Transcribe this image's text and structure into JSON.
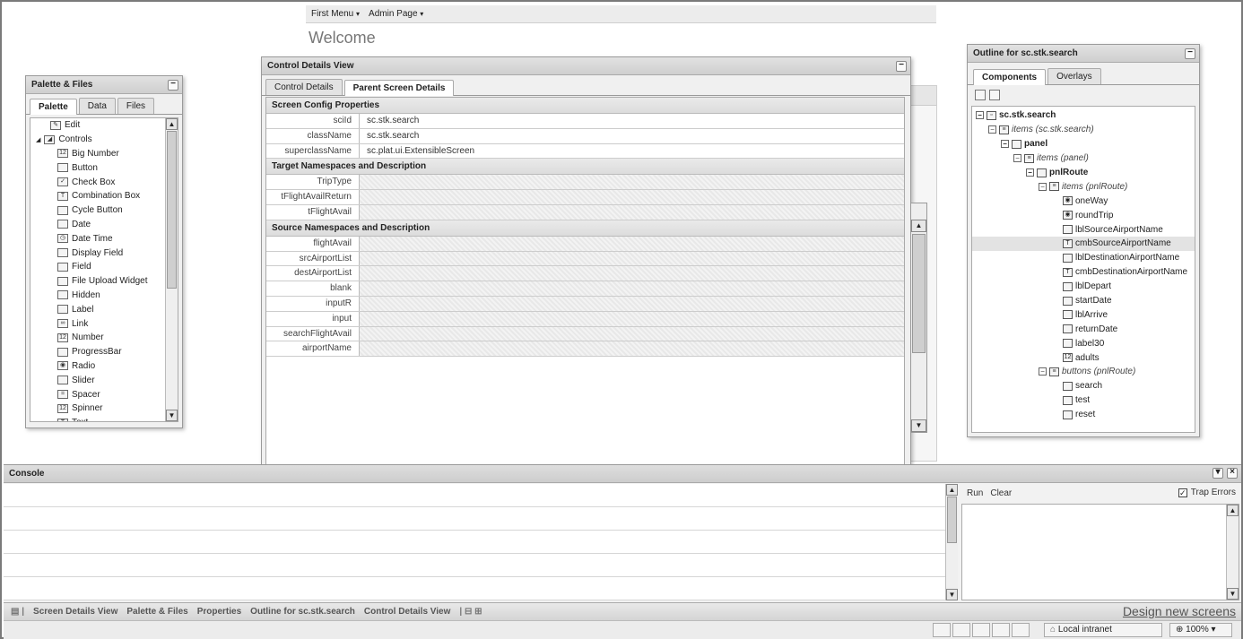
{
  "top_menu": {
    "items": [
      {
        "label": "First Menu"
      },
      {
        "label": "Admin Page"
      }
    ],
    "caret": "▾",
    "welcome": "Welcome"
  },
  "palette": {
    "title": "Palette & Files",
    "tabs": [
      "Palette",
      "Data",
      "Files"
    ],
    "items": [
      {
        "label": "Edit",
        "icon": "pencil-icon",
        "glyph": "✎",
        "level": 0
      },
      {
        "label": "Controls",
        "icon": "folder-icon",
        "glyph": "◢",
        "level": 0
      },
      {
        "label": "Big Number",
        "icon": "number-icon",
        "glyph": "12",
        "level": 2
      },
      {
        "label": "Button",
        "icon": "button-icon",
        "glyph": "",
        "level": 2
      },
      {
        "label": "Check Box",
        "icon": "checkbox-icon",
        "glyph": "✓",
        "level": 2
      },
      {
        "label": "Combination Box",
        "icon": "combobox-icon",
        "glyph": "T",
        "level": 2
      },
      {
        "label": "Cycle Button",
        "icon": "cycle-button-icon",
        "glyph": "",
        "level": 2
      },
      {
        "label": "Date",
        "icon": "calendar-icon",
        "glyph": "",
        "level": 2
      },
      {
        "label": "Date Time",
        "icon": "clock-icon",
        "glyph": "◷",
        "level": 2
      },
      {
        "label": "Display Field",
        "icon": "display-field-icon",
        "glyph": "",
        "level": 2
      },
      {
        "label": "Field",
        "icon": "field-icon",
        "glyph": "",
        "level": 2
      },
      {
        "label": "File Upload Widget",
        "icon": "file-upload-icon",
        "glyph": "",
        "level": 2
      },
      {
        "label": "Hidden",
        "icon": "hidden-icon",
        "glyph": "",
        "level": 2
      },
      {
        "label": "Label",
        "icon": "label-icon",
        "glyph": "",
        "level": 2
      },
      {
        "label": "Link",
        "icon": "link-icon",
        "glyph": "∞",
        "level": 2
      },
      {
        "label": "Number",
        "icon": "number-icon",
        "glyph": "12",
        "level": 2
      },
      {
        "label": "ProgressBar",
        "icon": "progressbar-icon",
        "glyph": "",
        "level": 2
      },
      {
        "label": "Radio",
        "icon": "radio-icon",
        "glyph": "◉",
        "level": 2
      },
      {
        "label": "Slider",
        "icon": "slider-icon",
        "glyph": "",
        "level": 2
      },
      {
        "label": "Spacer",
        "icon": "spacer-icon",
        "glyph": "=",
        "level": 2
      },
      {
        "label": "Spinner",
        "icon": "spinner-icon",
        "glyph": "12",
        "level": 2
      },
      {
        "label": "Text",
        "icon": "text-icon",
        "glyph": "T",
        "level": 2
      }
    ]
  },
  "control_details": {
    "title": "Control Details View",
    "tabs": [
      "Control Details",
      "Parent Screen Details"
    ],
    "sections": [
      {
        "title": "Screen Config Properties",
        "rows": [
          {
            "key": "sciId",
            "value": "sc.stk.search"
          },
          {
            "key": "className",
            "value": "sc.stk.search"
          },
          {
            "key": "superclassName",
            "value": "sc.plat.ui.ExtensibleScreen"
          }
        ]
      },
      {
        "title": "Target Namespaces and Description",
        "rows": [
          {
            "key": "TripType",
            "value": ""
          },
          {
            "key": "tFlightAvailReturn",
            "value": ""
          },
          {
            "key": "tFlightAvail",
            "value": ""
          }
        ]
      },
      {
        "title": "Source Namespaces and Description",
        "rows": [
          {
            "key": "flightAvail",
            "value": ""
          },
          {
            "key": "srcAirportList",
            "value": ""
          },
          {
            "key": "destAirportList",
            "value": ""
          },
          {
            "key": "blank",
            "value": ""
          },
          {
            "key": "inputR",
            "value": ""
          },
          {
            "key": "input",
            "value": ""
          },
          {
            "key": "searchFlightAvail",
            "value": ""
          },
          {
            "key": "airportName",
            "value": ""
          }
        ]
      }
    ]
  },
  "outline": {
    "title": "Outline for sc.stk.search",
    "tabs": [
      "Components",
      "Overlays"
    ],
    "tree": [
      {
        "label": "sc.stk.search",
        "depth": 0,
        "style": "bold",
        "expander": "⊟",
        "icon": "screen-icon",
        "glyph": "▫"
      },
      {
        "label": "items (sc.stk.search)",
        "depth": 1,
        "style": "it",
        "expander": "⊟",
        "icon": "list-icon",
        "glyph": "≡"
      },
      {
        "label": "panel",
        "depth": 2,
        "style": "bold",
        "expander": "⊟",
        "icon": "panel-icon",
        "glyph": ""
      },
      {
        "label": "items (panel)",
        "depth": 3,
        "style": "it",
        "expander": "⊟",
        "icon": "list-icon",
        "glyph": "≡"
      },
      {
        "label": "pnlRoute",
        "depth": 4,
        "style": "bold",
        "expander": "⊟",
        "icon": "panel-icon",
        "glyph": ""
      },
      {
        "label": "items (pnlRoute)",
        "depth": 5,
        "style": "it",
        "expander": "⊟",
        "icon": "list-icon",
        "glyph": "≡"
      },
      {
        "label": "oneWay",
        "depth": 6,
        "style": "",
        "expander": "",
        "icon": "radio-icon",
        "glyph": "◉"
      },
      {
        "label": "roundTrip",
        "depth": 6,
        "style": "",
        "expander": "",
        "icon": "radio-icon",
        "glyph": "◉"
      },
      {
        "label": "lblSourceAirportName",
        "depth": 6,
        "style": "",
        "expander": "",
        "icon": "label-icon",
        "glyph": ""
      },
      {
        "label": "cmbSourceAirportName",
        "depth": 6,
        "style": "sel",
        "expander": "",
        "icon": "combobox-icon",
        "glyph": "T"
      },
      {
        "label": "lblDestinationAirportName",
        "depth": 6,
        "style": "",
        "expander": "",
        "icon": "label-icon",
        "glyph": ""
      },
      {
        "label": "cmbDestinationAirportName",
        "depth": 6,
        "style": "",
        "expander": "",
        "icon": "combobox-icon",
        "glyph": "T"
      },
      {
        "label": "lblDepart",
        "depth": 6,
        "style": "",
        "expander": "",
        "icon": "label-icon",
        "glyph": ""
      },
      {
        "label": "startDate",
        "depth": 6,
        "style": "",
        "expander": "",
        "icon": "calendar-icon",
        "glyph": ""
      },
      {
        "label": "lblArrive",
        "depth": 6,
        "style": "",
        "expander": "",
        "icon": "label-icon",
        "glyph": ""
      },
      {
        "label": "returnDate",
        "depth": 6,
        "style": "",
        "expander": "",
        "icon": "calendar-icon",
        "glyph": ""
      },
      {
        "label": "label30",
        "depth": 6,
        "style": "",
        "expander": "",
        "icon": "label-icon",
        "glyph": ""
      },
      {
        "label": "adults",
        "depth": 6,
        "style": "",
        "expander": "",
        "icon": "spinner-icon",
        "glyph": "12"
      },
      {
        "label": "buttons (pnlRoute)",
        "depth": 5,
        "style": "it",
        "expander": "⊟",
        "icon": "list-icon",
        "glyph": "≡"
      },
      {
        "label": "search",
        "depth": 6,
        "style": "",
        "expander": "",
        "icon": "button-icon",
        "glyph": ""
      },
      {
        "label": "test",
        "depth": 6,
        "style": "",
        "expander": "",
        "icon": "button-icon",
        "glyph": ""
      },
      {
        "label": "reset",
        "depth": 6,
        "style": "",
        "expander": "",
        "icon": "button-icon",
        "glyph": ""
      }
    ]
  },
  "console": {
    "title": "Console",
    "run_label": "Run",
    "clear_label": "Clear",
    "trap_errors_label": "Trap Errors",
    "trap_errors_checked": true
  },
  "taskbar": {
    "items": [
      "Screen Details View",
      "Palette & Files",
      "Properties",
      "Outline for sc.stk.search",
      "Control Details View"
    ],
    "design_link": "Design new screens"
  },
  "statusbar": {
    "zone": "Local intranet",
    "zoom": "100%"
  }
}
